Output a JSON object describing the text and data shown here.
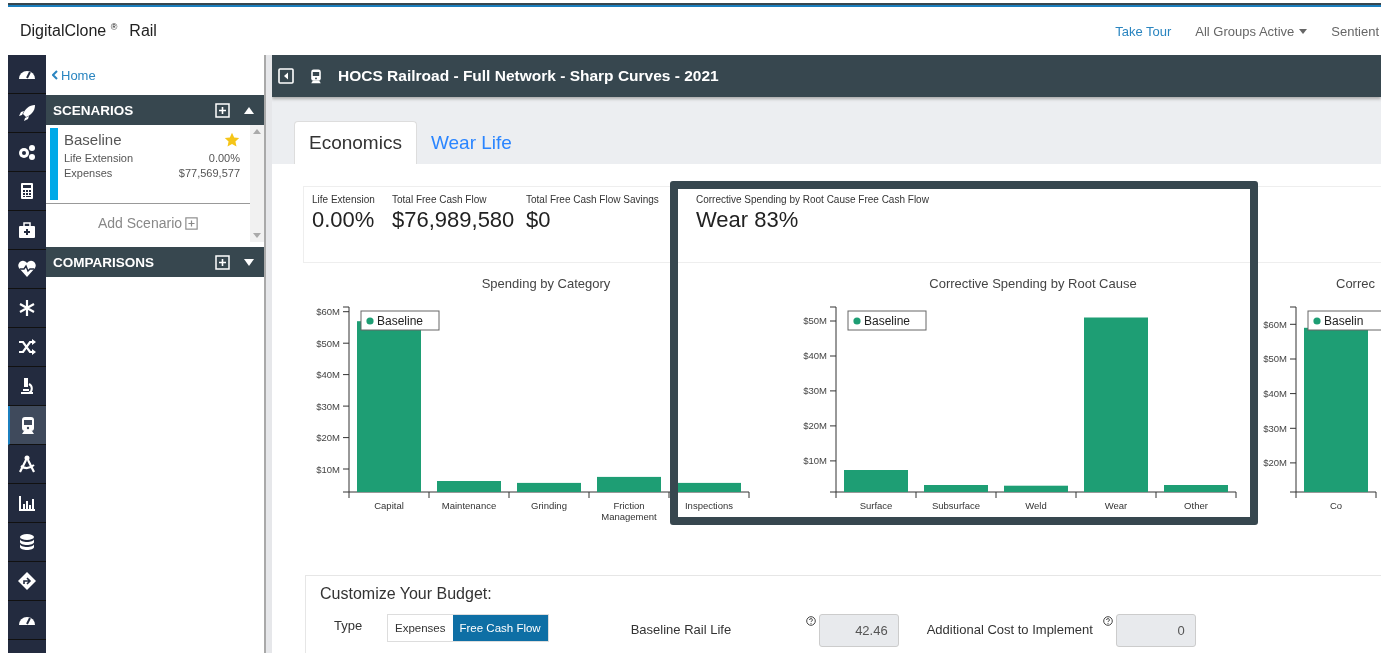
{
  "header": {
    "brand": "DigitalClone $^{®}$",
    "product": "Rail",
    "nav": [
      {
        "label": "Take Tour",
        "kind": "link"
      },
      {
        "label": "All Groups Active",
        "kind": "dropdown"
      },
      {
        "label": "Sentient",
        "kind": "text"
      }
    ]
  },
  "rail": [
    {
      "selected": false
    },
    {
      "selected": false
    },
    {
      "selected": false
    },
    {
      "selected": false
    },
    {
      "selected": false
    },
    {
      "selected": false
    },
    {
      "selected": false
    },
    {
      "selected": false
    },
    {
      "selected": false
    },
    {
      "selected": true
    },
    {
      "selected": false
    },
    {
      "selected": false
    },
    {
      "selected": false
    },
    {
      "selected": false
    },
    {
      "selected": false
    }
  ],
  "panel": {
    "home": "Home",
    "scenarios": {
      "title": "SCENARIOS",
      "expanded": true,
      "items": [
        {
          "name": "Baseline",
          "color": "#00a9e8",
          "favorite": true,
          "rows": [
            {
              "label": "Life Extension",
              "value": "0.00%"
            },
            {
              "label": "Expenses",
              "value": "$77,569,577"
            }
          ]
        }
      ],
      "add": "Add Scenario"
    },
    "comparisons": {
      "title": "COMPARISONS",
      "expanded": false
    }
  },
  "titlebar": {
    "title": "HOCS Railroad - Full Network - Sharp Curves - 2021"
  },
  "tabs": [
    {
      "label": "Economics",
      "selected": true
    },
    {
      "label": "Wear Life",
      "selected": false
    }
  ],
  "metrics": [
    {
      "label": "Life Extension",
      "value": "0.00%"
    },
    {
      "label": "Total Free Cash Flow",
      "value": "$76,989,580"
    },
    {
      "label": "Total Free Cash Flow Savings",
      "value": "$0"
    },
    {
      "label": "Corrective Spending by Root Cause Free Cash Flow",
      "value": "Wear 83%"
    }
  ],
  "charts": [
    {
      "chart_data": {
        "type": "bar",
        "title": "Spending by Category",
        "categories": [
          "Capital",
          "Maintenance",
          "Grinding",
          "Friction Management",
          "Inspections"
        ],
        "series": [
          {
            "name": "Baseline",
            "color": "#1e9e74",
            "values": [
              57,
              6.2,
              5.6,
              7.5,
              5.6
            ]
          }
        ],
        "ylim": [
          2.7,
          61.5
        ],
        "yticks": [
          {
            "value": 10,
            "label": "$10M"
          },
          {
            "value": 20,
            "label": "$20M"
          },
          {
            "value": 30,
            "label": "$30M"
          },
          {
            "value": 40,
            "label": "$40M"
          },
          {
            "value": 50,
            "label": "$50M"
          },
          {
            "value": 60,
            "label": "$60M"
          }
        ]
      }
    },
    {
      "chart_data": {
        "type": "bar",
        "title": "Corrective Spending by Root Cause",
        "categories": [
          "Surface",
          "Subsurface",
          "Weld",
          "Wear",
          "Other"
        ],
        "series": [
          {
            "name": "Baseline",
            "color": "#1e9e74",
            "values": [
              7.4,
              3.1,
              2.9,
              51,
              3.1
            ]
          }
        ],
        "ylim": [
          1.1,
          54
        ],
        "yticks": [
          {
            "value": 10,
            "label": "$10M"
          },
          {
            "value": 20,
            "label": "$20M"
          },
          {
            "value": 30,
            "label": "$30M"
          },
          {
            "value": 40,
            "label": "$40M"
          },
          {
            "value": 50,
            "label": "$50M"
          }
        ]
      }
    },
    {
      "chart_data": {
        "type": "bar",
        "title": "Correc",
        "categories": [
          "Co"
        ],
        "series": [
          {
            "name": "Baselin",
            "color": "#1e9e74",
            "values": [
              59
            ]
          }
        ],
        "ylim": [
          11.6,
          65
        ],
        "yticks": [
          {
            "value": 20,
            "label": "$20M"
          },
          {
            "value": 30,
            "label": "$30M"
          },
          {
            "value": 40,
            "label": "$40M"
          },
          {
            "value": 50,
            "label": "$50M"
          },
          {
            "value": 60,
            "label": "$60M"
          }
        ]
      }
    }
  ],
  "highlight_frame": true,
  "budget": {
    "title": "Customize Your Budget:",
    "type_label": "Type",
    "type_options": [
      {
        "label": "Expenses",
        "selected": false
      },
      {
        "label": "Free Cash Flow",
        "selected": true
      }
    ],
    "fields": [
      {
        "label": "Baseline Rail Life",
        "value": "42.46",
        "disabled": true
      },
      {
        "label": "Additional Cost to Implement",
        "value": "0",
        "disabled": true
      }
    ]
  }
}
